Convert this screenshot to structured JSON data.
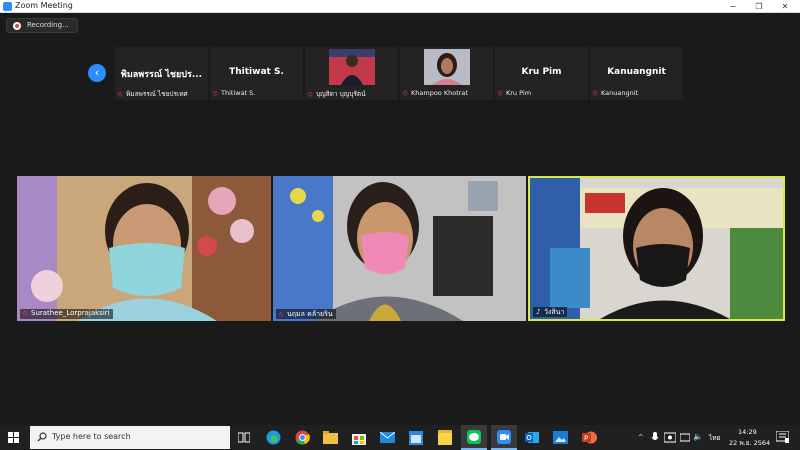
{
  "window": {
    "title": "Zoom Meeting",
    "minimize": "−",
    "maximize": "❐",
    "close": "✕"
  },
  "recording": {
    "label": "Recording..."
  },
  "strip": {
    "prev": "‹",
    "tiles": [
      {
        "big_name": "พิมลพรรณ์ ไชยปร...",
        "name": "พิมลพรรณ์ ไชยปรเทศ"
      },
      {
        "big_name": "Thitiwat S.",
        "name": "Thitiwat S."
      },
      {
        "big_name": "",
        "name": "บุญสิตา บุญบุรัตน์"
      },
      {
        "big_name": "",
        "name": "Khampoo Khotrat"
      },
      {
        "big_name": "Kru Pim",
        "name": "Kru Pim"
      },
      {
        "big_name": "Kanuangnit",
        "name": "Kanuangnit"
      }
    ]
  },
  "videos": [
    {
      "name": "Surathee_Lorprajaksiri"
    },
    {
      "name": "นฤมล คล้ายริน"
    },
    {
      "name": "วังสินา"
    }
  ],
  "taskbar": {
    "search_placeholder": "Type here to search",
    "lang": "ไทย",
    "time": "14:29",
    "date": "22 พ.ย. 2564"
  },
  "colors": {
    "accent": "#2d8cff",
    "active_speaker": "#d6e84a",
    "mic_muted": "#e0453a"
  }
}
